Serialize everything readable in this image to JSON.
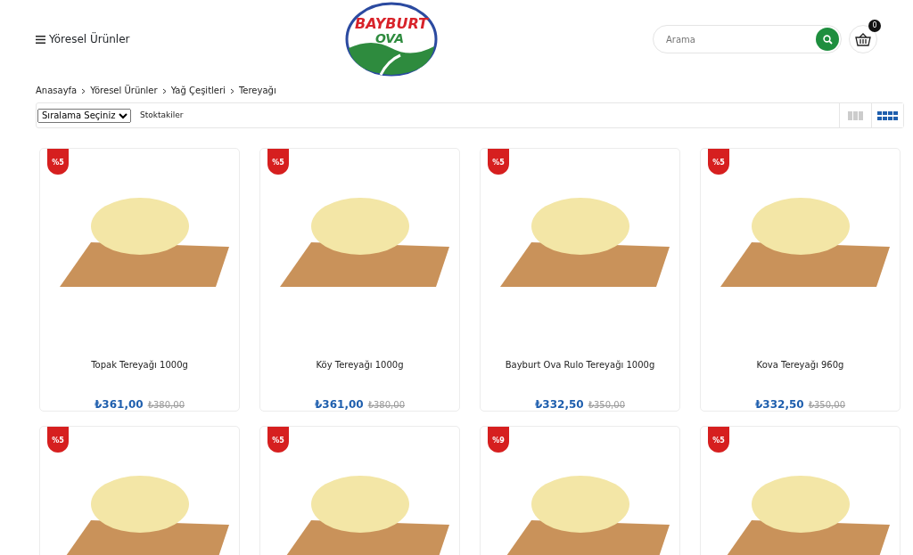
{
  "header": {
    "menu_label": "Yöresel Ürünler",
    "logo": {
      "line_1": "BAYBURT",
      "line_2": "OVA"
    },
    "search": {
      "placeholder": "Arama"
    },
    "cart_count": "0"
  },
  "breadcrumb": [
    "Anasayfa",
    "Yöresel Ürünler",
    "Yağ Çeşitleri",
    "Tereyağı"
  ],
  "toolbar": {
    "sort_select": "Sıralama Seçiniz",
    "stock_filter": "Stoktakiler",
    "view_options": [
      {
        "kind": "three",
        "selected": false
      },
      {
        "kind": "four",
        "selected": true
      }
    ]
  },
  "products": [
    {
      "badge": "%5",
      "name": "Topak Tereyağı 1000g",
      "price": "₺361,00",
      "old_price": "₺380,00"
    },
    {
      "badge": "%5",
      "name": "Köy Tereyağı 1000g",
      "price": "₺361,00",
      "old_price": "₺380,00"
    },
    {
      "badge": "%5",
      "name": "Bayburt Ova Rulo Tereyağı 1000g",
      "price": "₺332,50",
      "old_price": "₺350,00"
    },
    {
      "badge": "%5",
      "name": "Kova Tereyağı 960g",
      "price": "₺332,50",
      "old_price": "₺350,00"
    },
    {
      "badge": "%5"
    },
    {
      "badge": "%5"
    },
    {
      "badge": "%9"
    },
    {
      "badge": "%5"
    }
  ]
}
